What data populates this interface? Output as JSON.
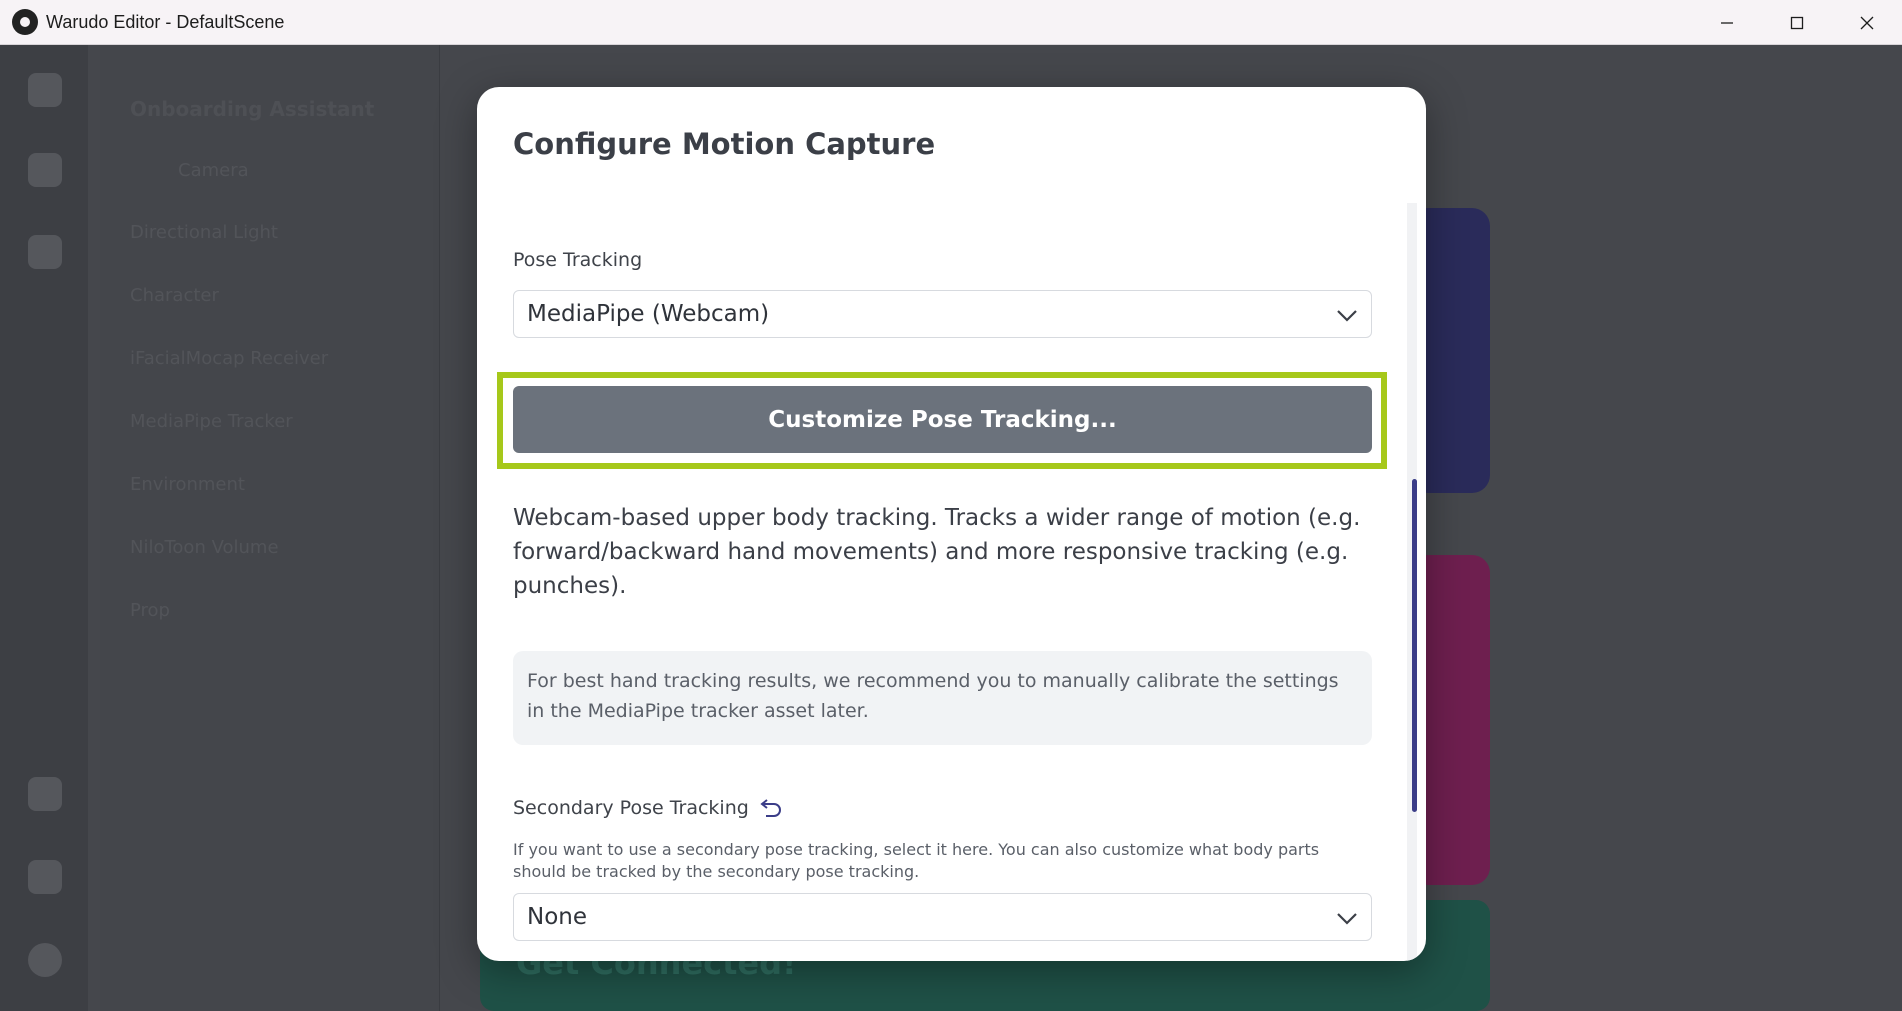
{
  "window": {
    "title": "Warudo Editor - DefaultScene",
    "controls": [
      "minimize",
      "maximize",
      "close"
    ]
  },
  "background": {
    "sidebar_heading": "Onboarding Assistant",
    "sidebar_items": [
      "Camera",
      "Directional Light",
      "Character",
      "iFacialMocap Receiver",
      "MediaPipe Tracker",
      "Environment",
      "NiloToon Volume",
      "Prop"
    ],
    "bottom_card_text": "Get Connected!"
  },
  "modal": {
    "title": "Configure Motion Capture",
    "pose_tracking": {
      "label": "Pose Tracking",
      "selected": "MediaPipe (Webcam)",
      "customize_button": "Customize Pose Tracking...",
      "description": "Webcam-based upper body tracking. Tracks a wider range of motion (e.g. forward/backward hand movements) and more responsive tracking (e.g. punches).",
      "info": "For best hand tracking results, we recommend you to manually calibrate the settings in the MediaPipe tracker asset later."
    },
    "secondary_pose_tracking": {
      "label": "Secondary Pose Tracking",
      "help": "If you want to use a secondary pose tracking, select it here. You can also customize what body parts should be tracked by the secondary pose tracking.",
      "selected": "None"
    }
  },
  "colors": {
    "highlight": "#a6c81a",
    "button": "#6b727c",
    "scroll_thumb": "#3b3d88"
  }
}
